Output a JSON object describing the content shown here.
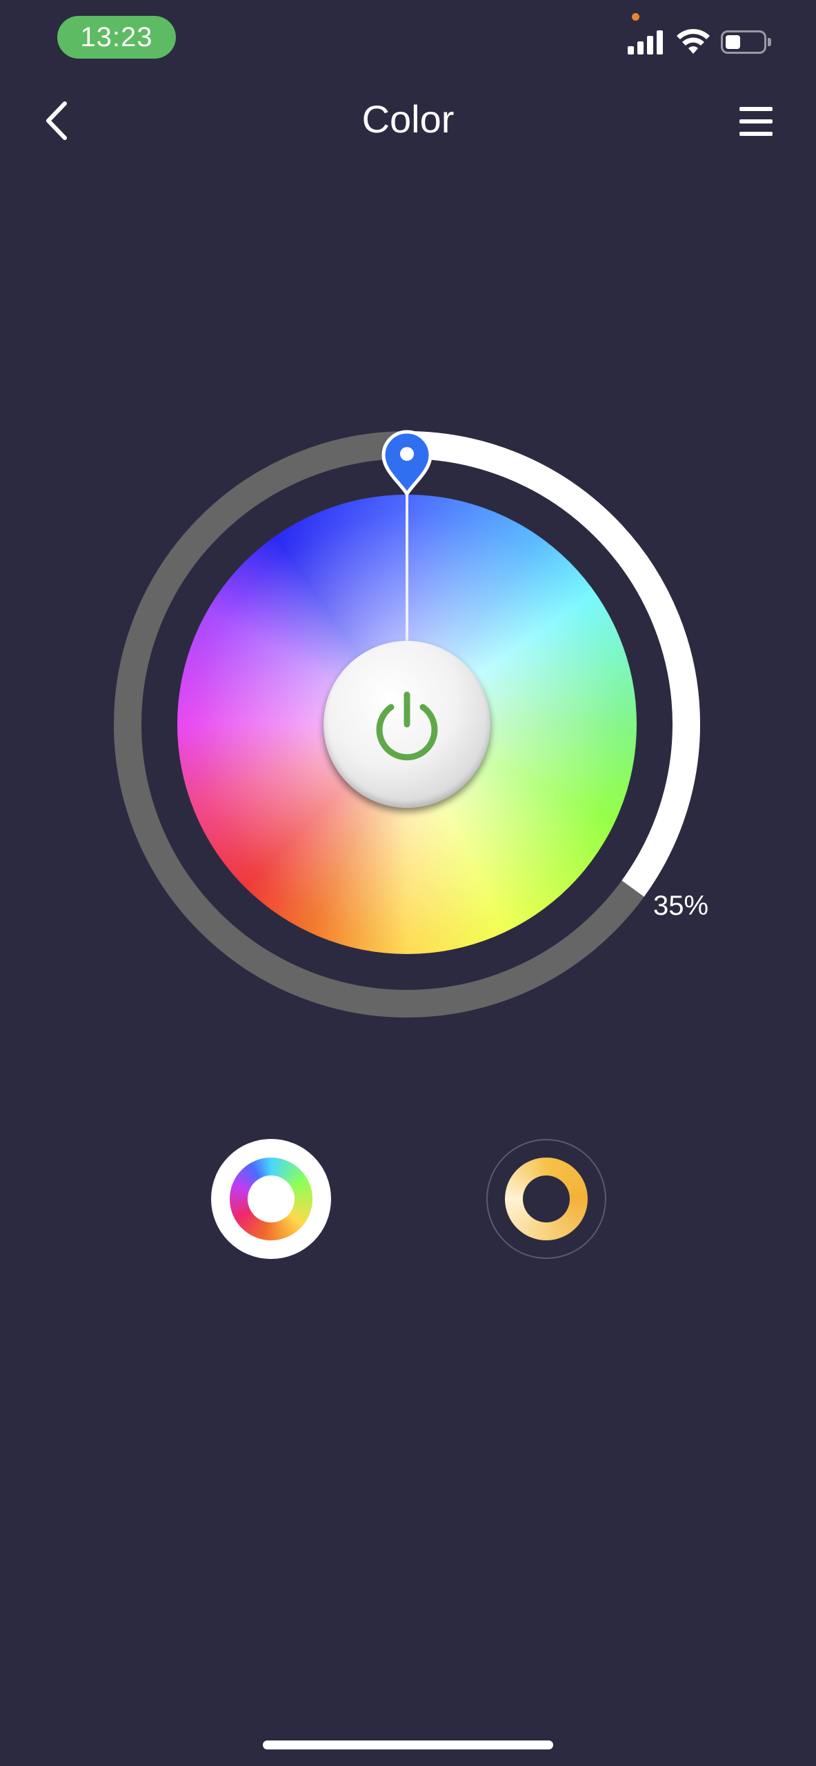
{
  "status_bar": {
    "time": "13:23",
    "battery_level": 0.4,
    "icons": [
      "mic-indicator-dot",
      "cellular-signal-icon",
      "wifi-icon",
      "battery-icon"
    ]
  },
  "header": {
    "title": "Color",
    "back_icon": "chevron-left-icon",
    "menu_icon": "hamburger-menu-icon"
  },
  "color_control": {
    "brightness_label": "35%",
    "brightness_value": 35,
    "selected_hue_color": "#2f6ff0",
    "power_icon": "power-icon",
    "power_icon_color": "#5fa84a",
    "ring_track_color": "#666666",
    "ring_fill_color": "#ffffff"
  },
  "modes": [
    {
      "name": "color-mode",
      "icon": "color-wheel-icon",
      "selected": true
    },
    {
      "name": "white-mode",
      "icon": "warm-white-wheel-icon",
      "selected": false
    }
  ]
}
